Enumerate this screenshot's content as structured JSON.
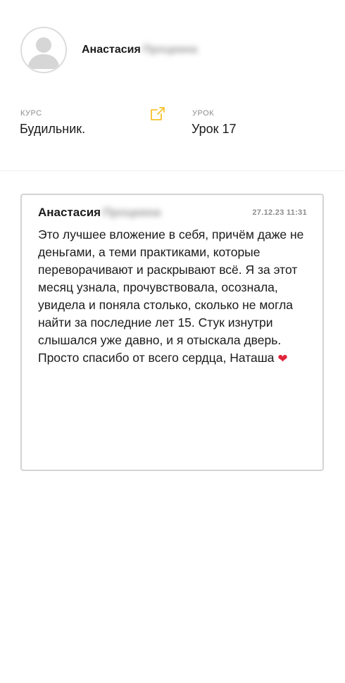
{
  "user": {
    "first_name": "Анастасия",
    "surname_blurred": "Процкина"
  },
  "course": {
    "caption": "КУРС",
    "value": "Будильник."
  },
  "lesson": {
    "caption": "УРОК",
    "value": "Урок 17"
  },
  "review": {
    "author_first_name": "Анастасия",
    "author_surname_blurred": "Процкина",
    "date": "27.12.23 11:31",
    "text": "Это лучшее вложение в себя, причём даже не деньгами, а теми практиками, которые переворачивают и раскрывают всё. Я за этот месяц узнала, прочувствовала, осознала, увидела и поняла столько, сколько не могла найти за последние лет 15. Стук изнутри слышался уже давно, и я отыскала дверь. Просто спасибо от всего сердца, Наташа",
    "emoji": "❤"
  },
  "icons": {
    "avatar": "user-placeholder-icon",
    "open_link": "external-link-icon",
    "heart": "red-heart-emoji"
  },
  "colors": {
    "accent": "#f5c22b",
    "heart": "#e0243a",
    "muted_text": "#8c8c8c",
    "border": "#d4d4d4"
  }
}
